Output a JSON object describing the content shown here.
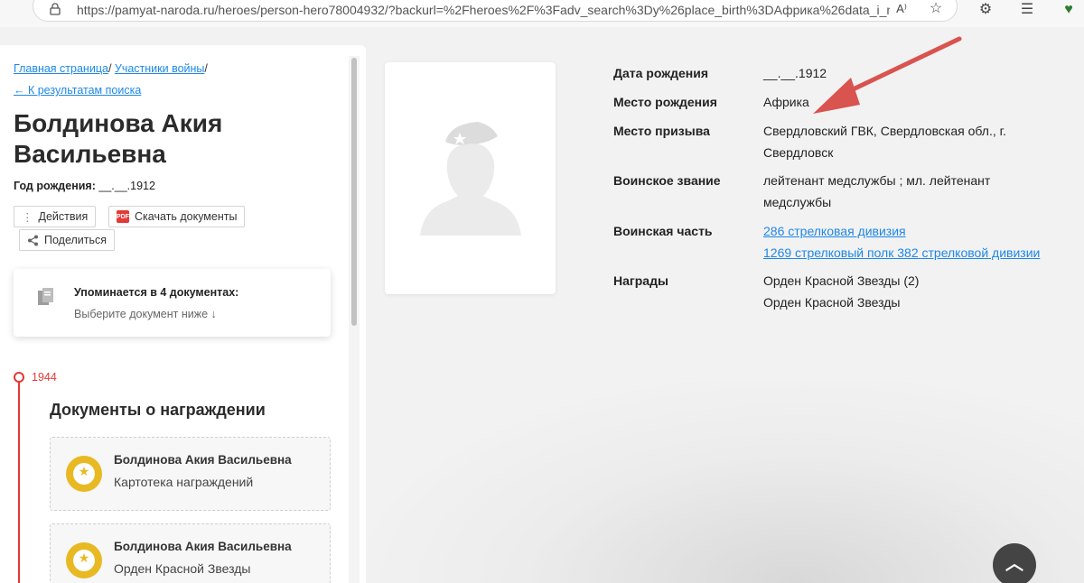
{
  "browser": {
    "url": "https://pamyat-naroda.ru/heroes/person-hero78004932/?backurl=%2Fheroes%2F%3Fadv_search%3Dy%26place_birth%3DАфрика%26data_i_m..."
  },
  "breadcrumbs": {
    "home": "Главная страница",
    "participants": "Участники войны",
    "back": "← К результатам поиска"
  },
  "hero": {
    "name": "Болдинова Акия Васильевна",
    "birth_label": "Год рождения:",
    "birth_value": "__.__.1912"
  },
  "actions": {
    "actions_label": "Действия",
    "download_label": "Скачать документы",
    "share_label": "Поделиться"
  },
  "mentions": {
    "title": "Упоминается в 4 документах:",
    "subtitle": "Выберите документ ниже ↓"
  },
  "timeline": {
    "year": "1944",
    "heading": "Документы о награждении",
    "documents": [
      {
        "name": "Болдинова Акия Васильевна",
        "type": "Картотека награждений"
      },
      {
        "name": "Болдинова Акия Васильевна",
        "type": "Орден Красной Звезды"
      }
    ]
  },
  "info": {
    "birth_date_label": "Дата рождения",
    "birth_date_value": "__.__.1912",
    "birth_place_label": "Место рождения",
    "birth_place_value": "Африка",
    "draft_place_label": "Место призыва",
    "draft_place_value": "Свердловский ГВК, Свердловская обл., г. Свердловск",
    "rank_label": "Воинское звание",
    "rank_value": "лейтенант медслужбы ; мл. лейтенант медслужбы",
    "unit_label": "Воинская часть",
    "unit_links": [
      "286 стрелковая дивизия",
      "1269 стрелковый полк 382 стрелковой дивизии"
    ],
    "awards_label": "Награды",
    "awards": [
      "Орден Красной Звезды (2)",
      "Орден Красной Звезды"
    ]
  },
  "colors": {
    "link": "#1e88e5",
    "accent_red": "#e53935",
    "medal_gold": "#e8b923",
    "annotation_arrow": "#d9534f"
  }
}
